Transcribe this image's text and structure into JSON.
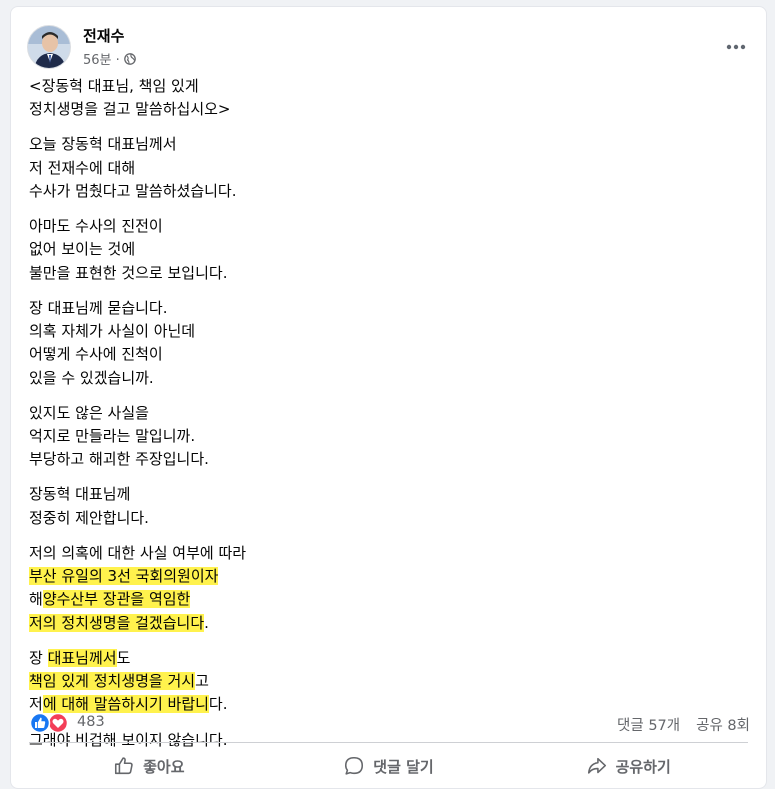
{
  "post": {
    "author": "전재수",
    "time": "56분 ·",
    "more_icon": "more-horizontal-icon",
    "privacy_icon": "globe-icon",
    "paragraphs": [
      {
        "lines": [
          {
            "segments": [
              {
                "text": "<장동혁 대표님, 책임 있게",
                "hl": false
              }
            ]
          },
          {
            "segments": [
              {
                "text": "정치생명을 걸고 말씀하십시오>",
                "hl": false
              }
            ]
          }
        ]
      },
      {
        "lines": [
          {
            "segments": [
              {
                "text": "오늘 장동혁 대표님께서",
                "hl": false
              }
            ]
          },
          {
            "segments": [
              {
                "text": "저 전재수에 대해",
                "hl": false
              }
            ]
          },
          {
            "segments": [
              {
                "text": "수사가 멈췄다고 말씀하셨습니다.",
                "hl": false
              }
            ]
          }
        ]
      },
      {
        "lines": [
          {
            "segments": [
              {
                "text": "아마도 수사의 진전이",
                "hl": false
              }
            ]
          },
          {
            "segments": [
              {
                "text": "없어 보이는 것에",
                "hl": false
              }
            ]
          },
          {
            "segments": [
              {
                "text": "불만을 표현한 것으로 보입니다.",
                "hl": false
              }
            ]
          }
        ]
      },
      {
        "lines": [
          {
            "segments": [
              {
                "text": "장 대표님께 묻습니다.",
                "hl": false
              }
            ]
          },
          {
            "segments": [
              {
                "text": "의혹 자체가 사실이 아닌데",
                "hl": false
              }
            ]
          },
          {
            "segments": [
              {
                "text": "어떻게 수사에 진척이",
                "hl": false
              }
            ]
          },
          {
            "segments": [
              {
                "text": "있을 수 있겠습니까.",
                "hl": false
              }
            ]
          }
        ]
      },
      {
        "lines": [
          {
            "segments": [
              {
                "text": "있지도 않은 사실을",
                "hl": false
              }
            ]
          },
          {
            "segments": [
              {
                "text": "억지로 만들라는 말입니까.",
                "hl": false
              }
            ]
          },
          {
            "segments": [
              {
                "text": "부당하고 해괴한 주장입니다.",
                "hl": false
              }
            ]
          }
        ]
      },
      {
        "lines": [
          {
            "segments": [
              {
                "text": "장동혁 대표님께",
                "hl": false
              }
            ]
          },
          {
            "segments": [
              {
                "text": "정중히 제안합니다.",
                "hl": false
              }
            ]
          }
        ]
      },
      {
        "lines": [
          {
            "segments": [
              {
                "text": "저의 의혹에 대한 사실 여부에 따라",
                "hl": false
              }
            ]
          },
          {
            "segments": [
              {
                "text": "부산 유일의 3선 국회의원이자",
                "hl": true
              }
            ]
          },
          {
            "segments": [
              {
                "text": "해",
                "hl": false
              },
              {
                "text": "양수산부 장관을 역임한",
                "hl": true
              }
            ]
          },
          {
            "segments": [
              {
                "text": "저의 정치생명을 걸겠습니다",
                "hl": true
              },
              {
                "text": ".",
                "hl": false
              }
            ]
          }
        ]
      },
      {
        "lines": [
          {
            "segments": [
              {
                "text": "장 ",
                "hl": false
              },
              {
                "text": "대표님께서",
                "hl": true
              },
              {
                "text": "도",
                "hl": false
              }
            ]
          },
          {
            "segments": [
              {
                "text": "책임 있게 정치생명을 거시",
                "hl": true
              },
              {
                "text": "고",
                "hl": false
              }
            ]
          },
          {
            "segments": [
              {
                "text": "저",
                "hl": false
              },
              {
                "text": "에 대해 말씀하시기 바랍니",
                "hl": true
              },
              {
                "text": "다.",
                "hl": false
              }
            ]
          }
        ]
      },
      {
        "lines": [
          {
            "segments": [
              {
                "text": "그래야 비겁해 보이지 않습니다.",
                "hl": false
              }
            ]
          }
        ]
      }
    ],
    "highlight_color": "#fff24d"
  },
  "stats": {
    "reaction_icons": [
      "like-icon",
      "love-icon"
    ],
    "reaction_count": "483",
    "comments": "댓글 57개",
    "shares": "공유 8회"
  },
  "actions": {
    "like_label": "좋아요",
    "comment_label": "댓글 달기",
    "share_label": "공유하기"
  }
}
